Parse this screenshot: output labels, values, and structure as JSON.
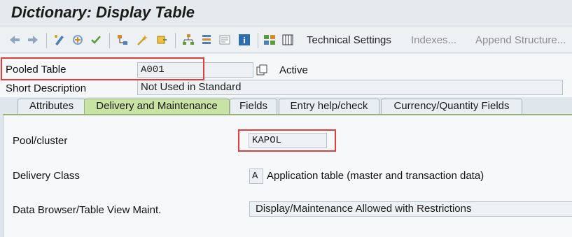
{
  "window": {
    "title": "Dictionary: Display Table"
  },
  "toolbar": {
    "icons": [
      "back-icon",
      "forward-icon",
      "display-change-icon",
      "activate-icon",
      "where-used-icon",
      "object-list-icon",
      "display-object-icon",
      "info-icon",
      "grid-icon",
      "table-icon"
    ],
    "technical_settings": "Technical Settings",
    "indexes": "Indexes...",
    "append_structure": "Append Structure..."
  },
  "header": {
    "pooled_table_label": "Pooled Table",
    "pooled_table_value": "A001",
    "status": "Active",
    "short_description_label": "Short Description",
    "short_description_value": "Not Used in Standard"
  },
  "tabs": [
    {
      "label": "Attributes",
      "active": false
    },
    {
      "label": "Delivery and Maintenance",
      "active": true
    },
    {
      "label": "Fields",
      "active": false
    },
    {
      "label": "Entry help/check",
      "active": false
    },
    {
      "label": "Currency/Quantity Fields",
      "active": false
    }
  ],
  "delivery": {
    "pool_cluster_label": "Pool/cluster",
    "pool_cluster_value": "KAPOL",
    "delivery_class_label": "Delivery Class",
    "delivery_class_code": "A",
    "delivery_class_desc": "Application table (master and transaction data)",
    "data_browser_label": "Data Browser/Table View Maint.",
    "data_browser_value": "Display/Maintenance Allowed with Restrictions"
  },
  "colors": {
    "active_tab": "#c8e3a3",
    "highlight": "#e23d3d"
  }
}
